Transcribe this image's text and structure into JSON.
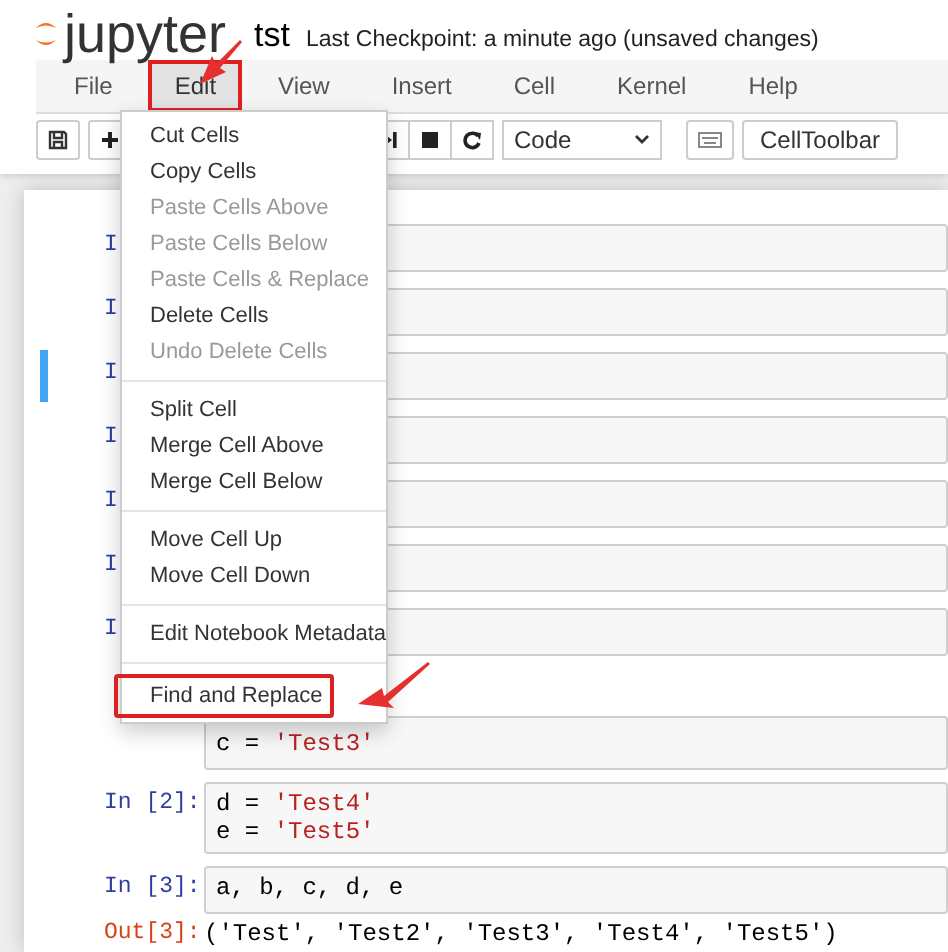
{
  "header": {
    "logo": "jupyter",
    "notebook_name": "tst",
    "checkpoint": "Last Checkpoint: a minute ago (unsaved changes)"
  },
  "menubar": [
    {
      "label": "File",
      "selected": false,
      "highlighted": false
    },
    {
      "label": "Edit",
      "selected": true,
      "highlighted": true
    },
    {
      "label": "View",
      "selected": false,
      "highlighted": false
    },
    {
      "label": "Insert",
      "selected": false,
      "highlighted": false
    },
    {
      "label": "Cell",
      "selected": false,
      "highlighted": false
    },
    {
      "label": "Kernel",
      "selected": false,
      "highlighted": false
    },
    {
      "label": "Help",
      "selected": false,
      "highlighted": false
    }
  ],
  "toolbar": {
    "cell_type": "Code",
    "celltoolbar": "CellToolbar"
  },
  "edit_menu": {
    "groups": [
      [
        {
          "label": "Cut Cells",
          "disabled": false,
          "highlighted": false
        },
        {
          "label": "Copy Cells",
          "disabled": false,
          "highlighted": false
        },
        {
          "label": "Paste Cells Above",
          "disabled": true,
          "highlighted": false
        },
        {
          "label": "Paste Cells Below",
          "disabled": true,
          "highlighted": false
        },
        {
          "label": "Paste Cells & Replace",
          "disabled": true,
          "highlighted": false
        },
        {
          "label": "Delete Cells",
          "disabled": false,
          "highlighted": false
        },
        {
          "label": "Undo Delete Cells",
          "disabled": true,
          "highlighted": false
        }
      ],
      [
        {
          "label": "Split Cell",
          "disabled": false,
          "highlighted": false
        },
        {
          "label": "Merge Cell Above",
          "disabled": false,
          "highlighted": false
        },
        {
          "label": "Merge Cell Below",
          "disabled": false,
          "highlighted": false
        }
      ],
      [
        {
          "label": "Move Cell Up",
          "disabled": false,
          "highlighted": false
        },
        {
          "label": "Move Cell Down",
          "disabled": false,
          "highlighted": false
        }
      ],
      [
        {
          "label": "Edit Notebook Metadata",
          "disabled": false,
          "highlighted": false
        }
      ],
      [
        {
          "label": "Find and Replace",
          "disabled": false,
          "highlighted": true
        }
      ]
    ]
  },
  "cells": [
    {
      "prompt": "I",
      "selected": false
    },
    {
      "prompt": "I",
      "selected": false
    },
    {
      "prompt": "I",
      "selected": true
    },
    {
      "prompt": "I",
      "selected": false
    },
    {
      "prompt": "I",
      "selected": false
    },
    {
      "prompt": "I",
      "selected": false
    },
    {
      "prompt": "I",
      "selected": false
    },
    {
      "selected": false,
      "lines": [
        [
          {
            "text": "c = ",
            "kind": "plain"
          },
          {
            "text": "'Test3'",
            "kind": "string"
          }
        ]
      ]
    },
    {
      "prompt": "In [2]:",
      "selected": false,
      "lines": [
        [
          {
            "text": "d = ",
            "kind": "plain"
          },
          {
            "text": "'Test4'",
            "kind": "string"
          }
        ],
        [
          {
            "text": "e = ",
            "kind": "plain"
          },
          {
            "text": "'Test5'",
            "kind": "string"
          }
        ]
      ]
    },
    {
      "prompt": "In [3]:",
      "selected": false,
      "lines": [
        [
          {
            "text": "a, b, c, d, e",
            "kind": "plain"
          }
        ]
      ],
      "output_prompt": "Out[3]:",
      "output": "('Test', 'Test2', 'Test3', 'Test4', 'Test5')"
    }
  ]
}
